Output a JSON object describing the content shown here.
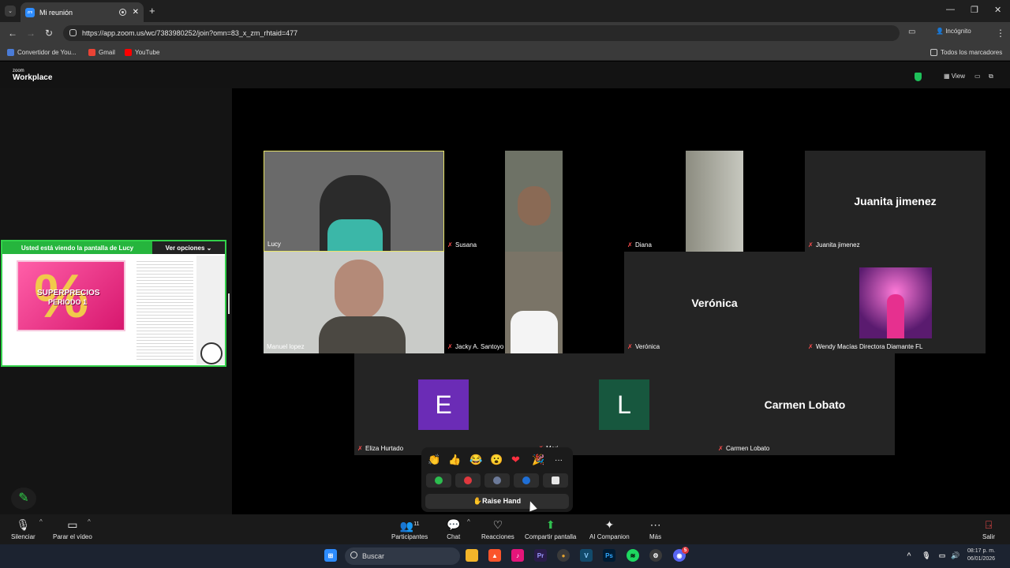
{
  "browser": {
    "tab_title": "Mi reunión",
    "url": "https://app.zoom.us/wc/7383980252/join?omn=83_x_zm_rhtaid=477",
    "mode_label": "Incógnito",
    "bookmarks": [
      "Convertidor de You...",
      "Gmail",
      "YouTube"
    ],
    "all_bookmarks": "Todos los marcadores"
  },
  "zoom": {
    "logo_small": "zoom",
    "logo_big": "Workplace",
    "view_label": "View",
    "share_banner": "Usted está viendo la pantalla de  Lucy",
    "view_options": "Ver opciones",
    "promo_title": "SUPERPRECIOS",
    "promo_subtitle": "PERIODO 1",
    "promo_pct": "%",
    "participants_grid": [
      {
        "name": "Lucy"
      },
      {
        "name": "Susana"
      },
      {
        "name": "Diana"
      },
      {
        "name": "Juanita jimenez",
        "big": "Juanita jimenez"
      },
      {
        "name": "Manuel lopez"
      },
      {
        "name": "Jacky A. Santoyo"
      },
      {
        "name": "Verónica",
        "big": "Verónica"
      },
      {
        "name": "Wendy Macías Directora Diamante FL"
      },
      {
        "name": "Eliza Hurtado",
        "initial": "E"
      },
      {
        "name": "Mari",
        "initial": "L"
      },
      {
        "name": "Carmen Lobato",
        "big": "Carmen Lobato"
      }
    ],
    "reactions": {
      "emojis": [
        "👏",
        "👍",
        "😂",
        "😮",
        "❤",
        "🎉",
        "···"
      ],
      "raise_hand": "✋Raise Hand"
    },
    "toolbar": {
      "mute": "Silenciar",
      "video": "Parar el vídeo",
      "participants": "Participantes",
      "participants_count": "11",
      "chat": "Chat",
      "reactions": "Reacciones",
      "share": "Compartir pantalla",
      "ai": "AI Companion",
      "more": "Más",
      "leave": "Salir"
    }
  },
  "taskbar": {
    "search": "Buscar",
    "time": "08:17 p. m.",
    "date": "06/01/2026",
    "discord_badge": "5"
  }
}
